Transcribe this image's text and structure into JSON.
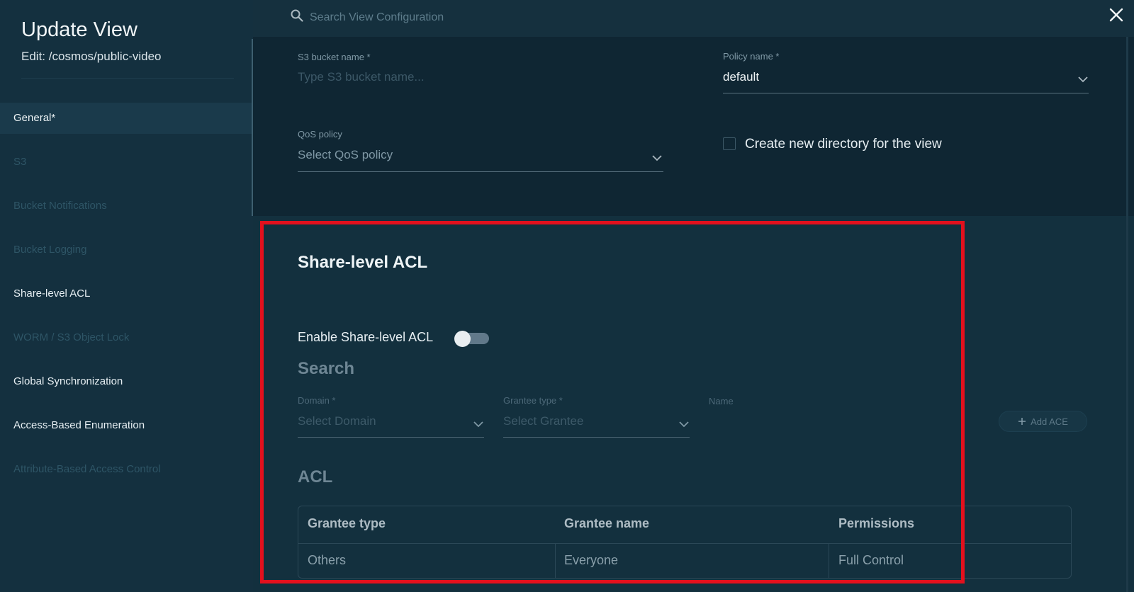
{
  "sidebar": {
    "title": "Update View",
    "subtitle_prefix": "Edit:",
    "subtitle_path": "/cosmos/public-video",
    "items": [
      {
        "label": "General*",
        "state": "active"
      },
      {
        "label": "S3",
        "state": "disabled"
      },
      {
        "label": "Bucket Notifications",
        "state": "disabled"
      },
      {
        "label": "Bucket Logging",
        "state": "disabled"
      },
      {
        "label": "Share-level ACL",
        "state": "enabled"
      },
      {
        "label": "WORM / S3 Object Lock",
        "state": "disabled"
      },
      {
        "label": "Global Synchronization",
        "state": "enabled"
      },
      {
        "label": "Access-Based Enumeration",
        "state": "enabled"
      },
      {
        "label": "Attribute-Based Access Control",
        "state": "disabled"
      }
    ]
  },
  "search": {
    "placeholder": "Search View Configuration",
    "icon": "search-icon"
  },
  "close": {
    "icon": "close-icon"
  },
  "form": {
    "s3_bucket": {
      "label": "S3 bucket name *",
      "placeholder": "Type S3 bucket name..."
    },
    "policy": {
      "label": "Policy name *",
      "value": "default"
    },
    "qos": {
      "label": "QoS policy",
      "placeholder": "Select QoS policy"
    },
    "create_dir": {
      "label": "Create new directory for the view",
      "checked": false
    }
  },
  "acl_section": {
    "title": "Share-level ACL",
    "enable_label": "Enable Share-level ACL",
    "enabled": false,
    "search_heading": "Search",
    "domain": {
      "label": "Domain *",
      "placeholder": "Select Domain"
    },
    "grantee_type": {
      "label": "Grantee type *",
      "placeholder": "Select Grantee"
    },
    "name": {
      "label": "Name"
    },
    "add_ace": "Add ACE",
    "acl_heading": "ACL",
    "table": {
      "headers": [
        "Grantee type",
        "Grantee name",
        "Permissions"
      ],
      "rows": [
        [
          "Others",
          "Everyone",
          "Full Control"
        ]
      ]
    }
  },
  "colors": {
    "highlight": "#e3101d",
    "background": "#14303f",
    "panel": "#0f2633"
  }
}
